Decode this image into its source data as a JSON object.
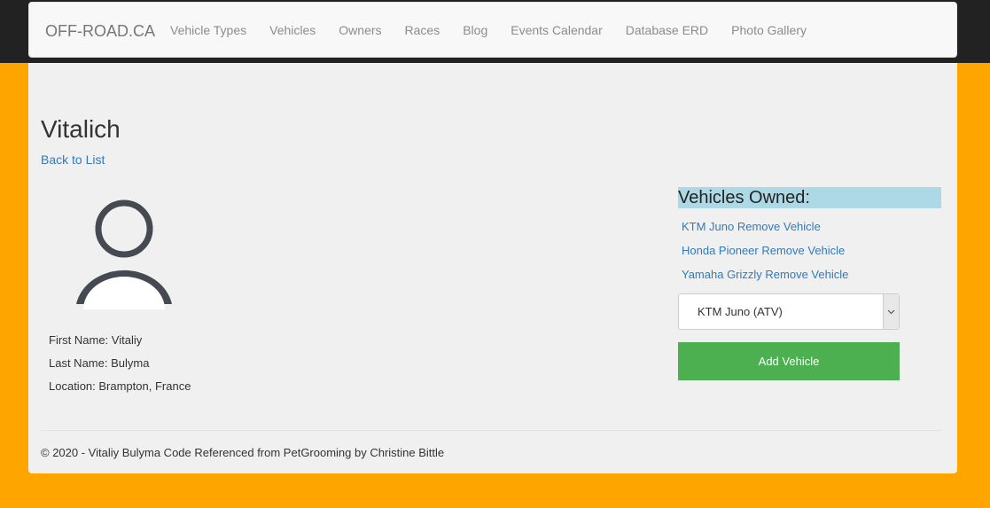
{
  "navbar": {
    "brand": "OFF-ROAD.CA",
    "links": [
      "Vehicle Types",
      "Vehicles",
      "Owners",
      "Races",
      "Blog",
      "Events Calendar",
      "Database ERD",
      "Photo Gallery"
    ]
  },
  "page": {
    "title": "Vitalich",
    "back_link": "Back to List"
  },
  "owner": {
    "avatar_icon": "user-silhouette-icon",
    "first_name": "First Name: Vitaliy",
    "last_name": "Last Name: Bulyma",
    "location": "Location: Brampton, France"
  },
  "vehicles_owned": {
    "heading": "Vehicles Owned:",
    "items": [
      "KTM Juno Remove Vehicle",
      "Honda Pioneer Remove Vehicle",
      "Yamaha Grizzly Remove Vehicle"
    ],
    "select_value": "KTM Juno (ATV)",
    "add_button": "Add Vehicle"
  },
  "footer": {
    "text": "© 2020 - Vitaliy Bulyma Code Referenced from PetGrooming by Christine Bittle"
  },
  "colors": {
    "background": "#FFA500",
    "topbar": "#222222",
    "navbar": "#f8f8f8",
    "content": "#f0f0f0",
    "link": "#337ab7",
    "heading_highlight": "#add8e6",
    "add_button": "#4CAF50"
  }
}
